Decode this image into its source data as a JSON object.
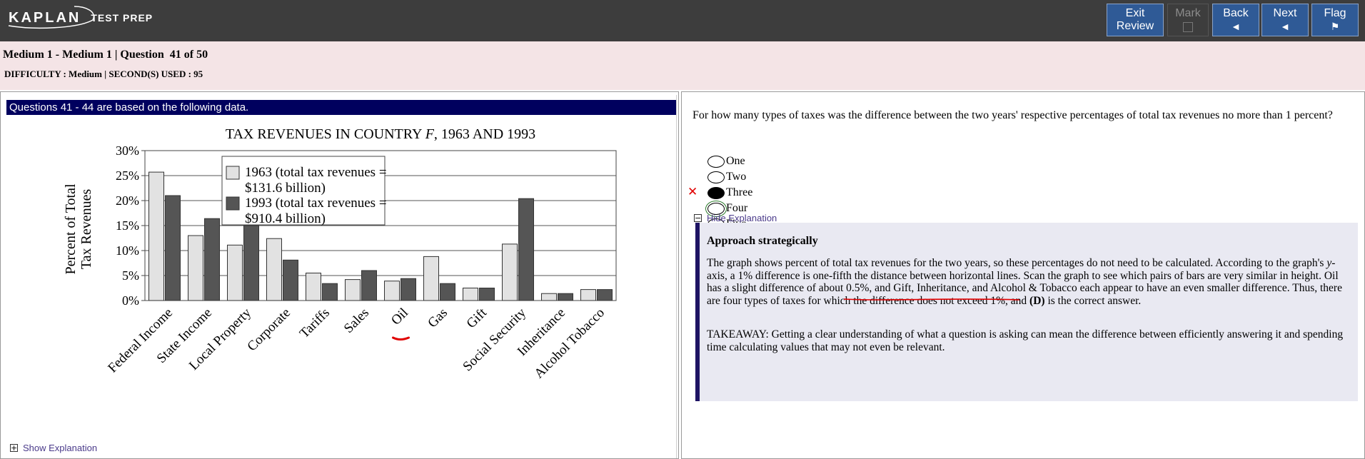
{
  "app": {
    "brand": "KAPLAN",
    "brand_sub": "TEST PREP"
  },
  "toolbar": {
    "exit_label_line1": "Exit",
    "exit_label_line2": "Review",
    "mark_label": "Mark",
    "back_label": "Back",
    "next_label": "Next",
    "flag_label": "Flag",
    "back_glyph": "◄",
    "next_glyph": "◄",
    "flag_glyph": "⚑",
    "mark_enabled": false
  },
  "header": {
    "title": "Medium 1 - Medium 1 | Question  41 of 50",
    "meta": "DIFFICULTY : Medium | SECOND(S) USED : 95"
  },
  "passage": {
    "banner": "Questions 41 - 44 are based on the following data.",
    "show_explanation": "Show Explanation",
    "show_icon": "plus-box-icon"
  },
  "chart_data": {
    "type": "bar",
    "title_prefix": "TAX REVENUES IN COUNTRY ",
    "title_italic": "F",
    "title_suffix": ", 1963 AND 1993",
    "ylabel_line1": "Percent of Total",
    "ylabel_line2": "Tax Revenues",
    "ylim": [
      0,
      30
    ],
    "yticks": [
      "0%",
      "5%",
      "10%",
      "15%",
      "20%",
      "25%",
      "30%"
    ],
    "grid": true,
    "legend_position": "top-center",
    "categories": [
      "Federal Income",
      "State Income",
      "Local Property",
      "Corporate",
      "Tariffs",
      "Sales",
      "Oil",
      "Gas",
      "Gift",
      "Social Security",
      "Inheritance",
      "Alcohol Tobacco"
    ],
    "series": [
      {
        "name_line1": "1963 (total tax revenues =",
        "name_line2": "$131.6 billion)",
        "color": "#e2e2e2",
        "values": [
          25.7,
          13.0,
          11.1,
          12.4,
          5.5,
          4.2,
          3.9,
          8.8,
          2.5,
          11.3,
          1.4,
          2.2
        ]
      },
      {
        "name_line1": "1993 (total tax revenues =",
        "name_line2": "$910.4 billion)",
        "color": "#555555",
        "values": [
          21.0,
          16.4,
          15.0,
          8.1,
          3.4,
          6.0,
          4.4,
          3.4,
          2.5,
          20.4,
          1.4,
          2.2
        ]
      }
    ],
    "highlight_category": "Oil",
    "highlight_color": "#e00000"
  },
  "question": {
    "text": "For how many types of taxes was the difference between the two years' respective percentages of total tax revenues no more than 1 percent?",
    "choices": [
      {
        "label": "One",
        "selected": false,
        "wrong": false,
        "focused": false
      },
      {
        "label": "Two",
        "selected": false,
        "wrong": false,
        "focused": false
      },
      {
        "label": "Three",
        "selected": true,
        "wrong": true,
        "focused": false
      },
      {
        "label": "Four",
        "selected": false,
        "wrong": false,
        "focused": true
      },
      {
        "label": "Five",
        "selected": false,
        "wrong": false,
        "focused": false
      }
    ],
    "wrong_mark": "✕",
    "hide_explanation": "Hide Explanation",
    "hide_icon": "minus-box-icon"
  },
  "explanation": {
    "heading": "Approach strategically",
    "body_parts": [
      "The graph shows percent of total tax revenues for the two years, so these percentages do not need to be calculated. According to the graph's ",
      "y",
      "-axis, a 1% difference is one-fifth the distance between horizontal lines. Scan the graph to see which pairs of bars are very similar in height. Oil has a slight difference of about 0.5%, and Gift, Inheritance, and Alcohol & Tobacco each appear to have an even smaller difference. Thus, there are four types of taxes for which the difference does not exceed 1%, and ",
      "(D)",
      " is the correct answer."
    ],
    "takeaway": "TAKEAWAY: Getting a clear understanding of what a question is asking can mean the difference between efficiently answering it and spending time calculating values that may not even be relevant.",
    "annotation_color": "#e00000"
  }
}
